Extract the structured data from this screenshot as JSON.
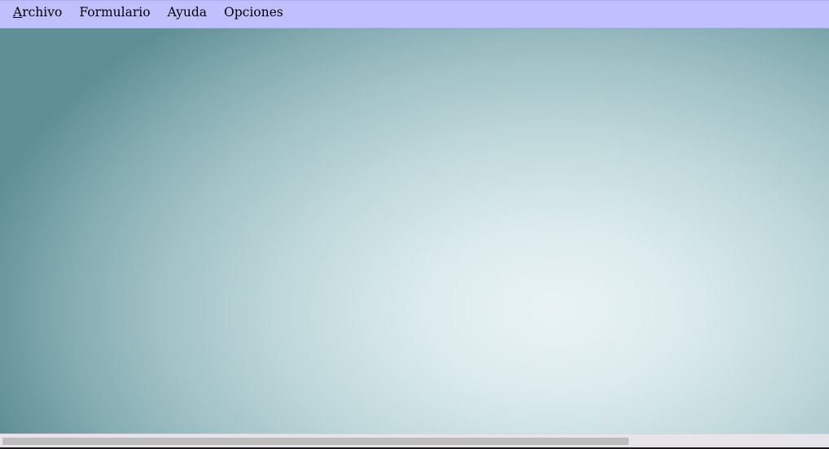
{
  "menubar": {
    "items": [
      {
        "mnemonic": "A",
        "rest": "rchivo"
      },
      {
        "label": "Formulario"
      },
      {
        "label": "Ayuda"
      },
      {
        "label": "Opciones"
      }
    ]
  },
  "colors": {
    "menubar_background": "#c0c0fe",
    "desktop_center": "#e9f3f4",
    "desktop_edge": "#5f8f94",
    "scrollbar_track": "#e6e4ea",
    "scrollbar_thumb": "#bdbdbd"
  },
  "scrollbar": {
    "horizontal_position_fraction": 0.0,
    "visible_fraction": 0.76
  }
}
